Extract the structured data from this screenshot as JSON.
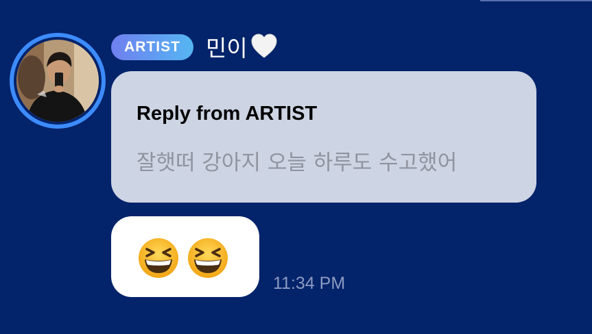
{
  "message": {
    "badge_label": "ARTIST",
    "sender_name": "민이",
    "sender_emoji": "white-heart-icon",
    "reply": {
      "title": "Reply from ARTIST",
      "text": "잘햇떠 강아지 오늘 하루도 수고했어"
    },
    "emoji_message": {
      "emojis": [
        "grinning-squinting-face-icon",
        "grinning-squinting-face-icon"
      ]
    },
    "timestamp": "11:34 PM"
  },
  "colors": {
    "background": "#03236a",
    "avatar_ring": "#3d8cff",
    "badge_gradient_start": "#6f7ff0",
    "badge_gradient_end": "#55b6f2",
    "reply_bubble": "#cdd4e3",
    "reply_text": "#8f94a0",
    "emoji_bubble": "#ffffff",
    "timestamp": "#8d9bc2"
  }
}
